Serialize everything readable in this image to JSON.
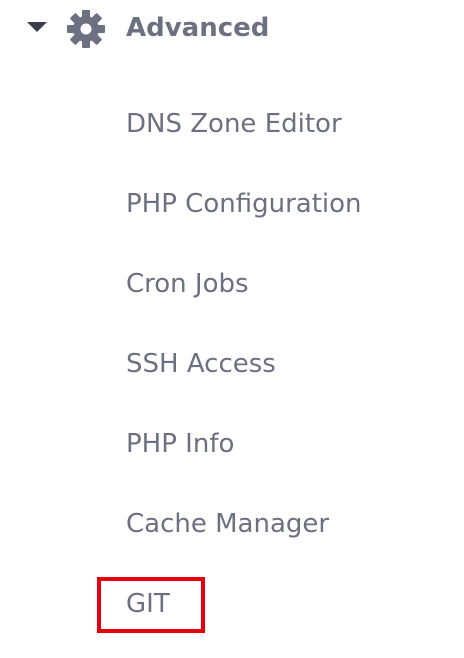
{
  "section": {
    "title": "Advanced",
    "icon": "gear-icon",
    "expanded": true
  },
  "menu": {
    "items": [
      {
        "label": "DNS Zone Editor"
      },
      {
        "label": "PHP Configuration"
      },
      {
        "label": "Cron Jobs"
      },
      {
        "label": "SSH Access"
      },
      {
        "label": "PHP Info"
      },
      {
        "label": "Cache Manager"
      },
      {
        "label": "GIT",
        "highlighted": true
      }
    ]
  },
  "colors": {
    "text": "#6d7081",
    "caret": "#3b3d4a",
    "highlight": "#e8000f",
    "background": "#ffffff"
  }
}
